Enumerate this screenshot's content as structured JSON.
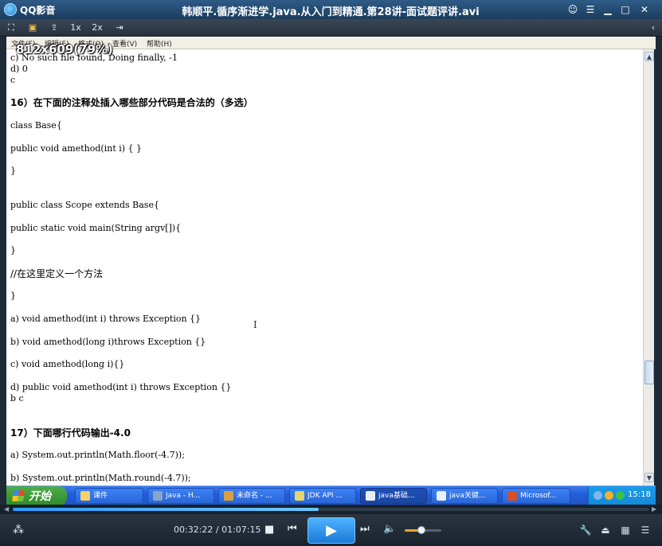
{
  "app": {
    "name": "QQ影音"
  },
  "window": {
    "title": "韩顺平.循序渐进学.java.从入门到精通.第28讲-面试题评讲.avi"
  },
  "title_buttons": [
    "chat-icon",
    "menu-icon",
    "minimize-icon",
    "maximize-icon",
    "close-icon"
  ],
  "toolbar": {
    "speed1": "1x",
    "speed2": "2x",
    "size_info": "812x609(79%)"
  },
  "doc_menu": [
    "文件(F)",
    "编辑(E)",
    "格式(O)",
    "查看(V)",
    "帮助(H)"
  ],
  "doc_lines": [
    "c) No such file found, Doing finally, -1",
    "d) 0",
    "c",
    "16）在下面的注释处插入哪些部分代码是合法的（多选）",
    "class Base{",
    " public void amethod(int i) { }",
    "}",
    "public class Scope extends Base{",
    " public static void main(String argv[]){",
    " }",
    " //在这里定义一个方法",
    "}",
    "a)  void amethod(int i) throws Exception {}",
    "b) void amethod(long i)throws Exception {}",
    "c) void amethod(long i){}",
    "d) public void amethod(int i) throws Exception {}",
    "b c",
    "17）下面哪行代码输出-4.0",
    "a) System.out.println(Math.floor(-4.7));",
    "b) System.out.println(Math.round(-4.7));"
  ],
  "taskbar": {
    "start_label": "开始",
    "tasks": [
      "课件",
      "Java - H...",
      "未命名 - ...",
      "JDK API ...",
      "java基础...",
      "java关键...",
      "Microsof..."
    ],
    "clock": "15:18"
  },
  "player": {
    "time": "00:32:22 / 01:07:15",
    "progress": 0.481,
    "volume": 0.45
  }
}
